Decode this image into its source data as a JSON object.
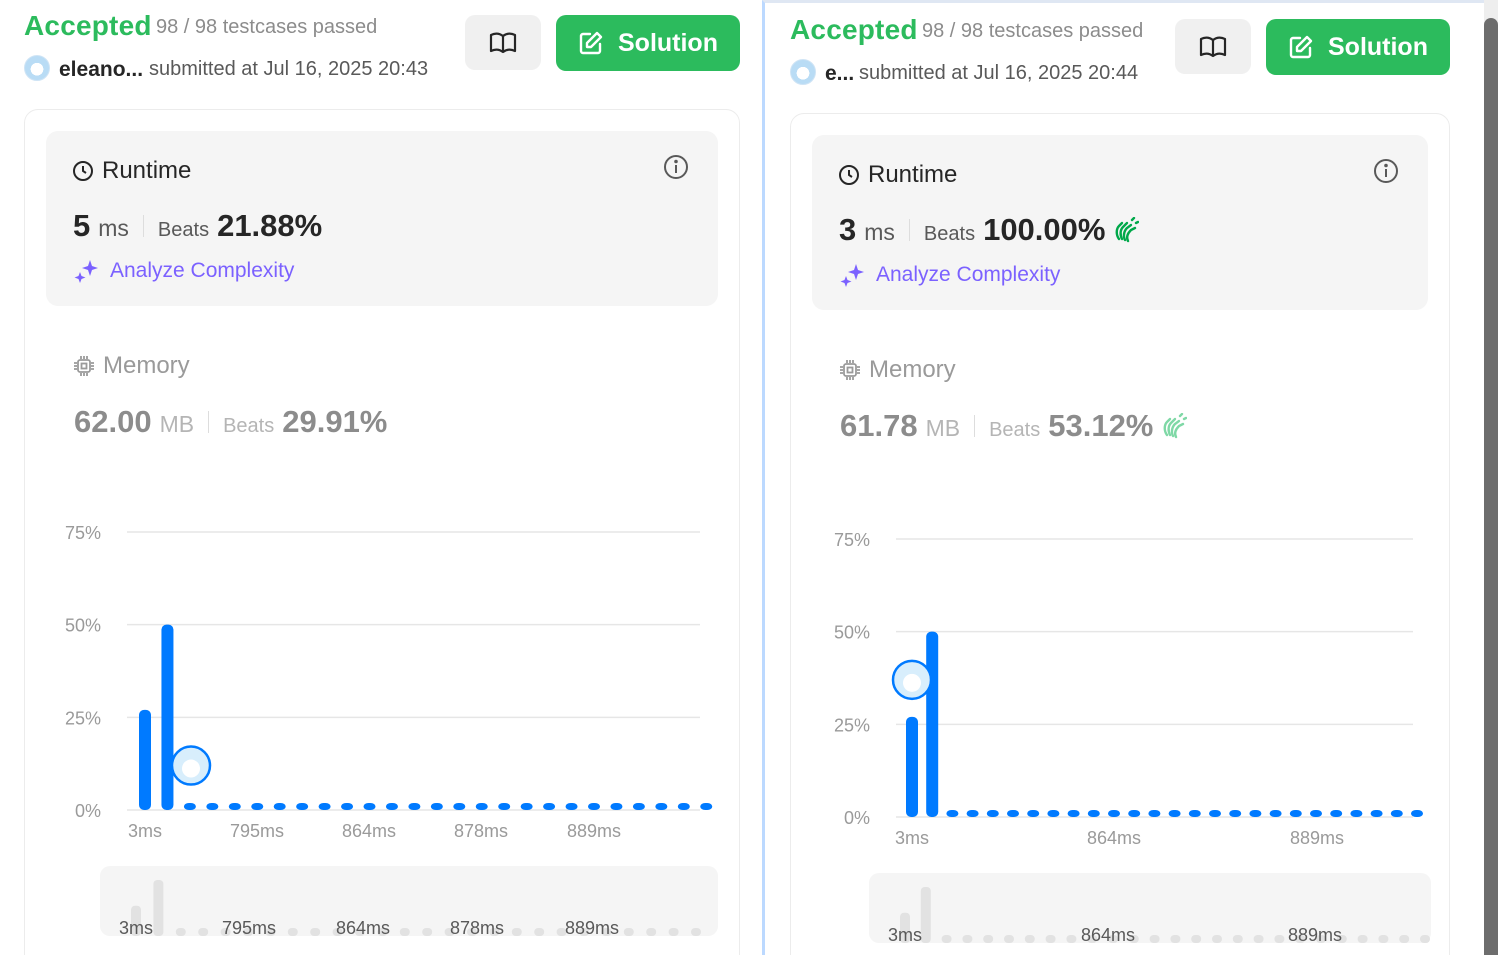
{
  "colors": {
    "accent_green": "#2cbb5d",
    "bar_blue": "#007aff",
    "analyze_purple": "#7b61ff",
    "clap_green": "#00a84a",
    "clap_light": "#7fd8a6"
  },
  "icons": {
    "book": "book-open-icon",
    "solution": "pencil-square-icon",
    "clock": "clock-icon",
    "info": "info-circle-icon",
    "memory": "cpu-chip-icon",
    "sparkle": "sparkle-icon",
    "clap": "clapping-hands-icon"
  },
  "left": {
    "status": "Accepted",
    "testcases": "98 / 98 testcases passed",
    "username": "eleano...",
    "submitted": "submitted at Jul 16, 2025 20:43",
    "solution_label": "Solution",
    "runtime": {
      "title": "Runtime",
      "value": "5",
      "unit": "ms",
      "beats_label": "Beats",
      "beats": "21.88%",
      "analyze": "Analyze Complexity"
    },
    "memory": {
      "title": "Memory",
      "value": "62.00",
      "unit": "MB",
      "beats_label": "Beats",
      "beats": "29.91%"
    },
    "chart_data": {
      "type": "bar",
      "y_ticks": [
        "75%",
        "50%",
        "25%",
        "0%"
      ],
      "ylim": [
        0,
        75
      ],
      "x_ticks": [
        "3ms",
        "795ms",
        "864ms",
        "878ms",
        "889ms"
      ],
      "values": [
        27,
        50,
        0.5,
        0.5,
        0.5,
        0.5,
        0.5,
        0.5,
        0.5,
        0.5,
        0.5,
        0.5,
        0.5,
        0.5,
        0.5,
        0.5,
        0.5,
        0.5,
        0.5,
        0.5,
        0.5,
        0.5,
        0.5,
        0.5,
        0.5,
        0.5
      ],
      "marker_value": 12,
      "mini_ticks": [
        "3ms",
        "795ms",
        "864ms",
        "878ms",
        "889ms"
      ]
    }
  },
  "right": {
    "status": "Accepted",
    "testcases": "98 / 98 testcases passed",
    "username": "e...",
    "submitted": "submitted at Jul 16, 2025 20:44",
    "solution_label": "Solution",
    "runtime": {
      "title": "Runtime",
      "value": "3",
      "unit": "ms",
      "beats_label": "Beats",
      "beats": "100.00%",
      "analyze": "Analyze Complexity"
    },
    "memory": {
      "title": "Memory",
      "value": "61.78",
      "unit": "MB",
      "beats_label": "Beats",
      "beats": "53.12%"
    },
    "chart_data": {
      "type": "bar",
      "y_ticks": [
        "75%",
        "50%",
        "25%",
        "0%"
      ],
      "ylim": [
        0,
        75
      ],
      "x_ticks": [
        "3ms",
        "864ms",
        "889ms"
      ],
      "values": [
        27,
        50,
        0.5,
        0.5,
        0.5,
        0.5,
        0.5,
        0.5,
        0.5,
        0.5,
        0.5,
        0.5,
        0.5,
        0.5,
        0.5,
        0.5,
        0.5,
        0.5,
        0.5,
        0.5,
        0.5,
        0.5,
        0.5,
        0.5,
        0.5,
        0.5
      ],
      "marker_value": 37,
      "mini_ticks": [
        "3ms",
        "864ms",
        "889ms"
      ]
    }
  }
}
